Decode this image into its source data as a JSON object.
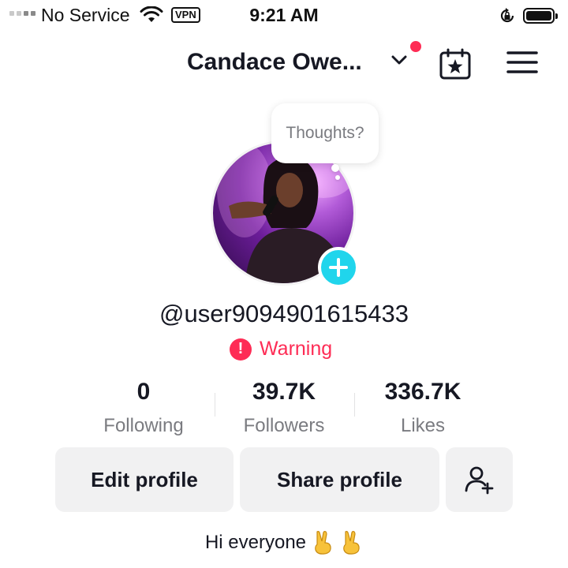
{
  "status_bar": {
    "carrier": "No Service",
    "vpn": "VPN",
    "time": "9:21 AM",
    "icons": [
      "signal-icon",
      "wifi-icon",
      "rotation-lock-icon",
      "battery-icon"
    ]
  },
  "header": {
    "profile_name": "Candace Owe...",
    "icons": [
      "chevron-down-icon",
      "calendar-star-icon",
      "menu-icon"
    ],
    "notification_dot_color": "#fe2c55"
  },
  "avatar": {
    "bubble_text": "Thoughts?",
    "add_button_color": "#20d5ec"
  },
  "profile": {
    "username": "@user9094901615433",
    "warning_label": "Warning",
    "warning_color": "#fe2c55"
  },
  "stats": [
    {
      "value": "0",
      "label": "Following"
    },
    {
      "value": "39.7K",
      "label": "Followers"
    },
    {
      "value": "336.7K",
      "label": "Likes"
    }
  ],
  "actions": {
    "edit_profile": "Edit profile",
    "share_profile": "Share profile",
    "add_friend_icon": "add-friend-icon"
  },
  "bio": {
    "text": "Hi everyone",
    "emojis": [
      "victory-hand",
      "victory-hand"
    ]
  }
}
